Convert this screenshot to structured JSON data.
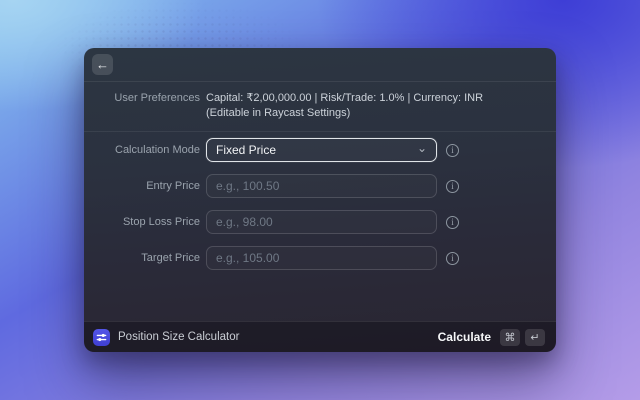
{
  "header": {
    "back_icon": "←"
  },
  "preferences": {
    "label": "User Preferences",
    "line1": "Capital: ₹2,00,000.00 | Risk/Trade: 1.0% | Currency: INR",
    "line2": "(Editable in Raycast Settings)"
  },
  "form": {
    "fields": [
      {
        "label": "Calculation Mode",
        "type": "dropdown",
        "value": "Fixed Price"
      },
      {
        "label": "Entry Price",
        "type": "text",
        "value": "",
        "placeholder": "e.g., 100.50"
      },
      {
        "label": "Stop Loss Price",
        "type": "text",
        "value": "",
        "placeholder": "e.g., 98.00"
      },
      {
        "label": "Target Price",
        "type": "text",
        "value": "",
        "placeholder": "e.g., 105.00"
      }
    ]
  },
  "footer": {
    "title": "Position Size Calculator",
    "primary_action": "Calculate",
    "shortcut": [
      "⌘",
      "↵"
    ]
  },
  "icons": {
    "chevron_down": "⌄",
    "info": "i"
  },
  "colors": {
    "accent_blue": "#4a4ae0",
    "focused_border": "#e0e4e8"
  }
}
